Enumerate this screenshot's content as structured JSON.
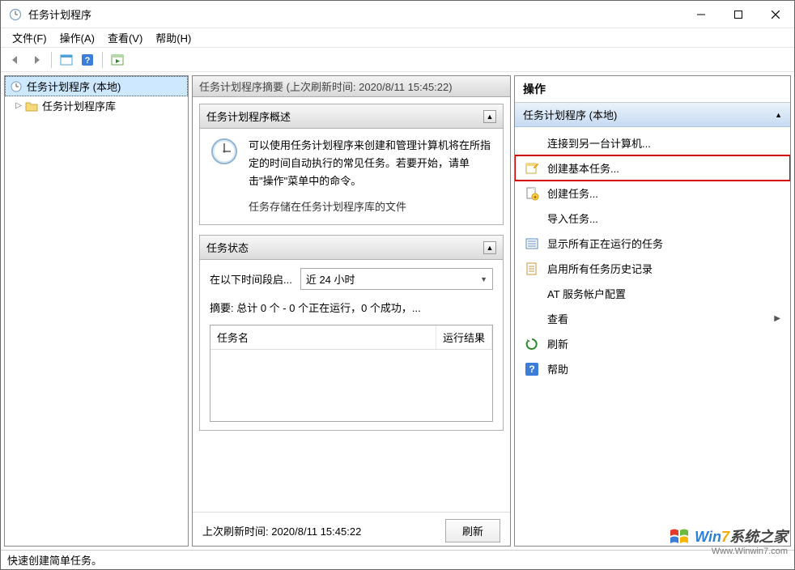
{
  "window": {
    "title": "任务计划程序"
  },
  "menu": {
    "file": "文件(F)",
    "action": "操作(A)",
    "view": "查看(V)",
    "help": "帮助(H)"
  },
  "tree": {
    "root": "任务计划程序 (本地)",
    "library": "任务计划程序库"
  },
  "center": {
    "header": "任务计划程序摘要 (上次刷新时间: 2020/8/11 15:45:22)",
    "overview_title": "任务计划程序概述",
    "overview_text": "可以使用任务计划程序来创建和管理计算机将在所指定的时间自动执行的常见任务。若要开始，请单击\"操作\"菜单中的命令。",
    "overview_footer": "任务存储在任务计划程序库的文件",
    "status_title": "任务状态",
    "status_label": "在以下时间段启...",
    "status_period": "近 24 小时",
    "status_summary": "摘要: 总计 0 个 - 0 个正在运行，0 个成功，...",
    "table": {
      "col1": "任务名",
      "col2": "运行结果"
    },
    "refresh_label": "上次刷新时间: 2020/8/11 15:45:22",
    "refresh_btn": "刷新"
  },
  "actions": {
    "title": "操作",
    "section_title": "任务计划程序 (本地)",
    "items": [
      {
        "key": "connect",
        "label": "连接到另一台计算机...",
        "icon": "blank"
      },
      {
        "key": "create-basic",
        "label": "创建基本任务...",
        "icon": "wizard",
        "highlighted": true
      },
      {
        "key": "create-task",
        "label": "创建任务...",
        "icon": "doc-new"
      },
      {
        "key": "import",
        "label": "导入任务...",
        "icon": "blank"
      },
      {
        "key": "show-running",
        "label": "显示所有正在运行的任务",
        "icon": "list"
      },
      {
        "key": "enable-history",
        "label": "启用所有任务历史记录",
        "icon": "doc"
      },
      {
        "key": "at-config",
        "label": "AT 服务帐户配置",
        "icon": "blank"
      },
      {
        "key": "view",
        "label": "查看",
        "icon": "blank",
        "expand": true
      },
      {
        "key": "refresh",
        "label": "刷新",
        "icon": "refresh"
      },
      {
        "key": "help",
        "label": "帮助",
        "icon": "help"
      }
    ]
  },
  "statusbar": "快速创建简单任务。",
  "watermark": {
    "brand_pre": "Win",
    "brand_num": "7",
    "brand_rest": "系统之家",
    "url": "Www.Winwin7.com"
  }
}
